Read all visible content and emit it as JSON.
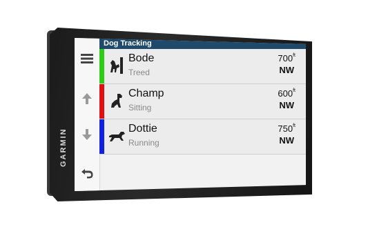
{
  "device": {
    "brand": "GARMIN"
  },
  "screen": {
    "title": "Dog Tracking"
  },
  "rail": {
    "menu_icon": "hamburger-menu-icon",
    "up_icon": "arrow-up-icon",
    "down_icon": "arrow-down-icon",
    "back_icon": "back-arrow-icon"
  },
  "dogs": [
    {
      "name": "Bode",
      "status": "Treed",
      "distance": "700",
      "unit": "ft",
      "direction": "NW",
      "color": "#2ecc17",
      "icon": "dog-treed-icon"
    },
    {
      "name": "Champ",
      "status": "Sitting",
      "distance": "600",
      "unit": "ft",
      "direction": "NW",
      "color": "#e01010",
      "icon": "dog-sitting-icon"
    },
    {
      "name": "Dottie",
      "status": "Running",
      "distance": "750",
      "unit": "ft",
      "direction": "NW",
      "color": "#1020e0",
      "icon": "dog-running-icon"
    }
  ]
}
